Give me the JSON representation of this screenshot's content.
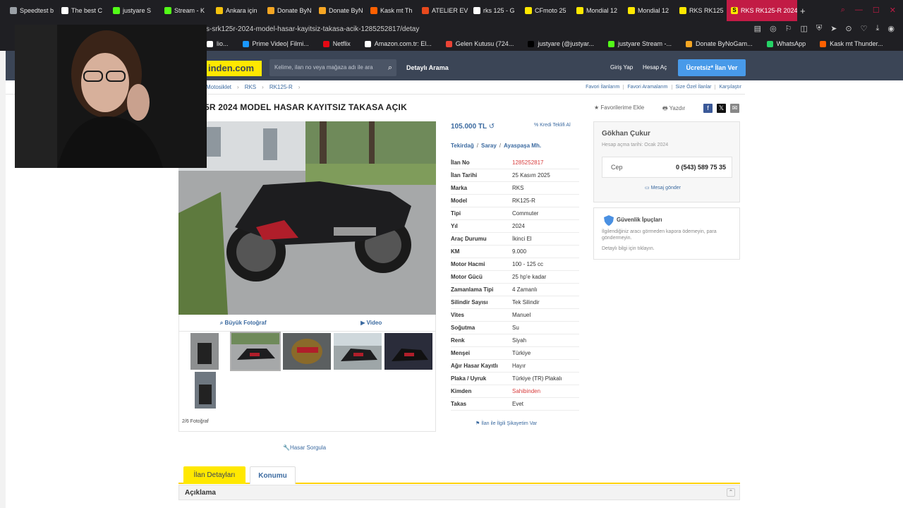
{
  "browser": {
    "tabs": [
      {
        "label": "Speedtest b",
        "color": "#9aa0a6"
      },
      {
        "label": "The best C",
        "color": "#ffffff"
      },
      {
        "label": "justyare S",
        "color": "#53fc18"
      },
      {
        "label": "Stream - K",
        "color": "#53fc18"
      },
      {
        "label": "Ankara için",
        "color": "#f4c20d"
      },
      {
        "label": "Donate ByN",
        "color": "#f6a623"
      },
      {
        "label": "Donate ByN",
        "color": "#f6a623"
      },
      {
        "label": "Kask mt Th",
        "color": "#ff6000"
      },
      {
        "label": "ATELIER EV",
        "color": "#e8491d"
      },
      {
        "label": "rks 125 - G",
        "color": "#ffffff"
      },
      {
        "label": "CFmoto 25",
        "color": "#ffe800"
      },
      {
        "label": "Mondial 12",
        "color": "#ffe800"
      },
      {
        "label": "Mondial 12",
        "color": "#ffe800"
      },
      {
        "label": "RKS RK125",
        "color": "#ffe800"
      }
    ],
    "active_tab": "RKS RK125-R 2024 M",
    "active_tab_icon": "S",
    "url": "s-srk125r-2024-model-hasar-kayitsiz-takasa-acik-1285252817/detay",
    "bookmarks": [
      {
        "label": "lio...",
        "color": "#ffffff"
      },
      {
        "label": "Prime Video| Filmi...",
        "color": "#1a98ff"
      },
      {
        "label": "Netflix",
        "color": "#e50914"
      },
      {
        "label": "Amazon.com.tr: El...",
        "color": "#ffffff"
      },
      {
        "label": "Gelen Kutusu (724...",
        "color": "#ea4335"
      },
      {
        "label": "justyare (@justyar...",
        "color": "#000000"
      },
      {
        "label": "justyare Stream -...",
        "color": "#53fc18"
      },
      {
        "label": "Donate ByNoGam...",
        "color": "#f6a623"
      },
      {
        "label": "WhatsApp",
        "color": "#25d366"
      },
      {
        "label": "Kask mt Thunder...",
        "color": "#ff6000"
      }
    ]
  },
  "site": {
    "logo": "inden.com",
    "search_placeholder": "Kelime, ilan no veya mağaza adı ile ara",
    "detay_arama": "Detaylı Arama",
    "giris": "Giriş Yap",
    "hesap": "Hesap Aç",
    "ilan_ver": "Ücretsiz* İlan Ver"
  },
  "breadcrumb": [
    "Motosiklet",
    "RKS",
    "RK125-R"
  ],
  "top_links": [
    "Favori İlanlarım",
    "Favori Aramalarım",
    "Size Özel İlanlar",
    "Karşılaştır"
  ],
  "listing": {
    "title": "5R 2024 MODEL HASAR KAYITSIZ TAKASA AÇIK",
    "fav_ekle": "Favorilerime Ekle",
    "yazdir": "Yazdır",
    "buyuk_foto": "Büyük Fotoğraf",
    "video": "Video",
    "photo_count": "2/6 Fotoğraf",
    "hasar_sorgula": "Hasar Sorgula",
    "price": "105.000 TL",
    "kredi": "Kredi Teklifi Al",
    "location": [
      "Tekirdağ",
      "Saray",
      "Ayaspaşa Mh."
    ],
    "attributes": [
      {
        "k": "İlan No",
        "v": "1285252817",
        "red": true
      },
      {
        "k": "İlan Tarihi",
        "v": "25 Kasım 2025",
        "red": false
      },
      {
        "k": "Marka",
        "v": "RKS",
        "red": false
      },
      {
        "k": "Model",
        "v": "RK125-R",
        "red": false
      },
      {
        "k": "Tipi",
        "v": "Commuter",
        "red": false
      },
      {
        "k": "Yıl",
        "v": "2024",
        "red": false
      },
      {
        "k": "Araç Durumu",
        "v": "İkinci El",
        "red": false
      },
      {
        "k": "KM",
        "v": "9.000",
        "red": false
      },
      {
        "k": "Motor Hacmi",
        "v": "100 - 125 cc",
        "red": false
      },
      {
        "k": "Motor Gücü",
        "v": "25 hp'e kadar",
        "red": false
      },
      {
        "k": "Zamanlama Tipi",
        "v": "4 Zamanlı",
        "red": false
      },
      {
        "k": "Silindir Sayısı",
        "v": "Tek Silindir",
        "red": false
      },
      {
        "k": "Vites",
        "v": "Manuel",
        "red": false
      },
      {
        "k": "Soğutma",
        "v": "Su",
        "red": false
      },
      {
        "k": "Renk",
        "v": "Siyah",
        "red": false
      },
      {
        "k": "Menşei",
        "v": "Türkiye",
        "red": false
      },
      {
        "k": "Ağır Hasar Kayıtlı",
        "v": "Hayır",
        "red": false
      },
      {
        "k": "Plaka / Uyruk",
        "v": "Türkiye (TR) Plakalı",
        "red": false
      },
      {
        "k": "Kimden",
        "v": "Sahibinden",
        "red": true
      },
      {
        "k": "Takas",
        "v": "Evet",
        "red": false
      }
    ],
    "sikayet": "İlan ile İlgili Şikayetim Var"
  },
  "seller": {
    "name": "Gökhan Çukur",
    "since": "Hesap açma tarihi: Ocak 2024",
    "phone_label": "Cep",
    "phone": "0 (543) 589 75 35",
    "mesaj": "Mesaj gönder"
  },
  "guvenlik": {
    "title": "Güvenlik İpuçları",
    "text": "İlgilendiğiniz aracı görmeden kapora ödemeyin, para göndermeyin.",
    "link": "Detaylı bilgi için tıklayın."
  },
  "bottom_tabs": {
    "detaylar": "İlan Detayları",
    "konumu": "Konumu",
    "aciklama": "Açıklama"
  }
}
